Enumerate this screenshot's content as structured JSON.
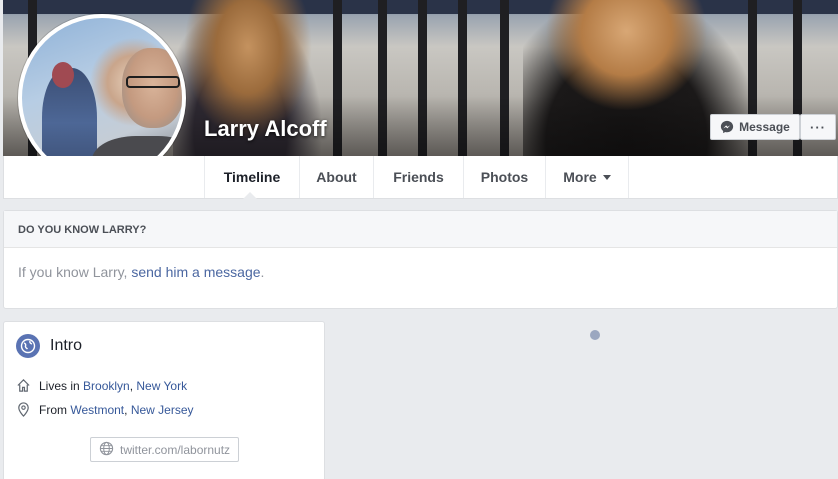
{
  "profile": {
    "name": "Larry Alcoff"
  },
  "actions": {
    "message_label": "Message",
    "more_label": "···"
  },
  "nav": {
    "tabs": [
      {
        "label": "Timeline"
      },
      {
        "label": "About"
      },
      {
        "label": "Friends"
      },
      {
        "label": "Photos"
      },
      {
        "label": "More"
      }
    ]
  },
  "know_card": {
    "header": "DO YOU KNOW LARRY?",
    "prefix": "If you know Larry, ",
    "link": "send him a message",
    "suffix": "."
  },
  "intro": {
    "title": "Intro",
    "lives_prefix": "Lives in ",
    "lives_city": "Brooklyn",
    "lives_sep": ", ",
    "lives_state": "New York",
    "from_prefix": "From ",
    "from_city": "Westmont",
    "from_sep": ", ",
    "from_state": "New Jersey",
    "website": "twitter.com/labornutz"
  },
  "colors": {
    "link": "#365899",
    "page_bg": "#e9ebee",
    "accent": "#5a73b3"
  }
}
